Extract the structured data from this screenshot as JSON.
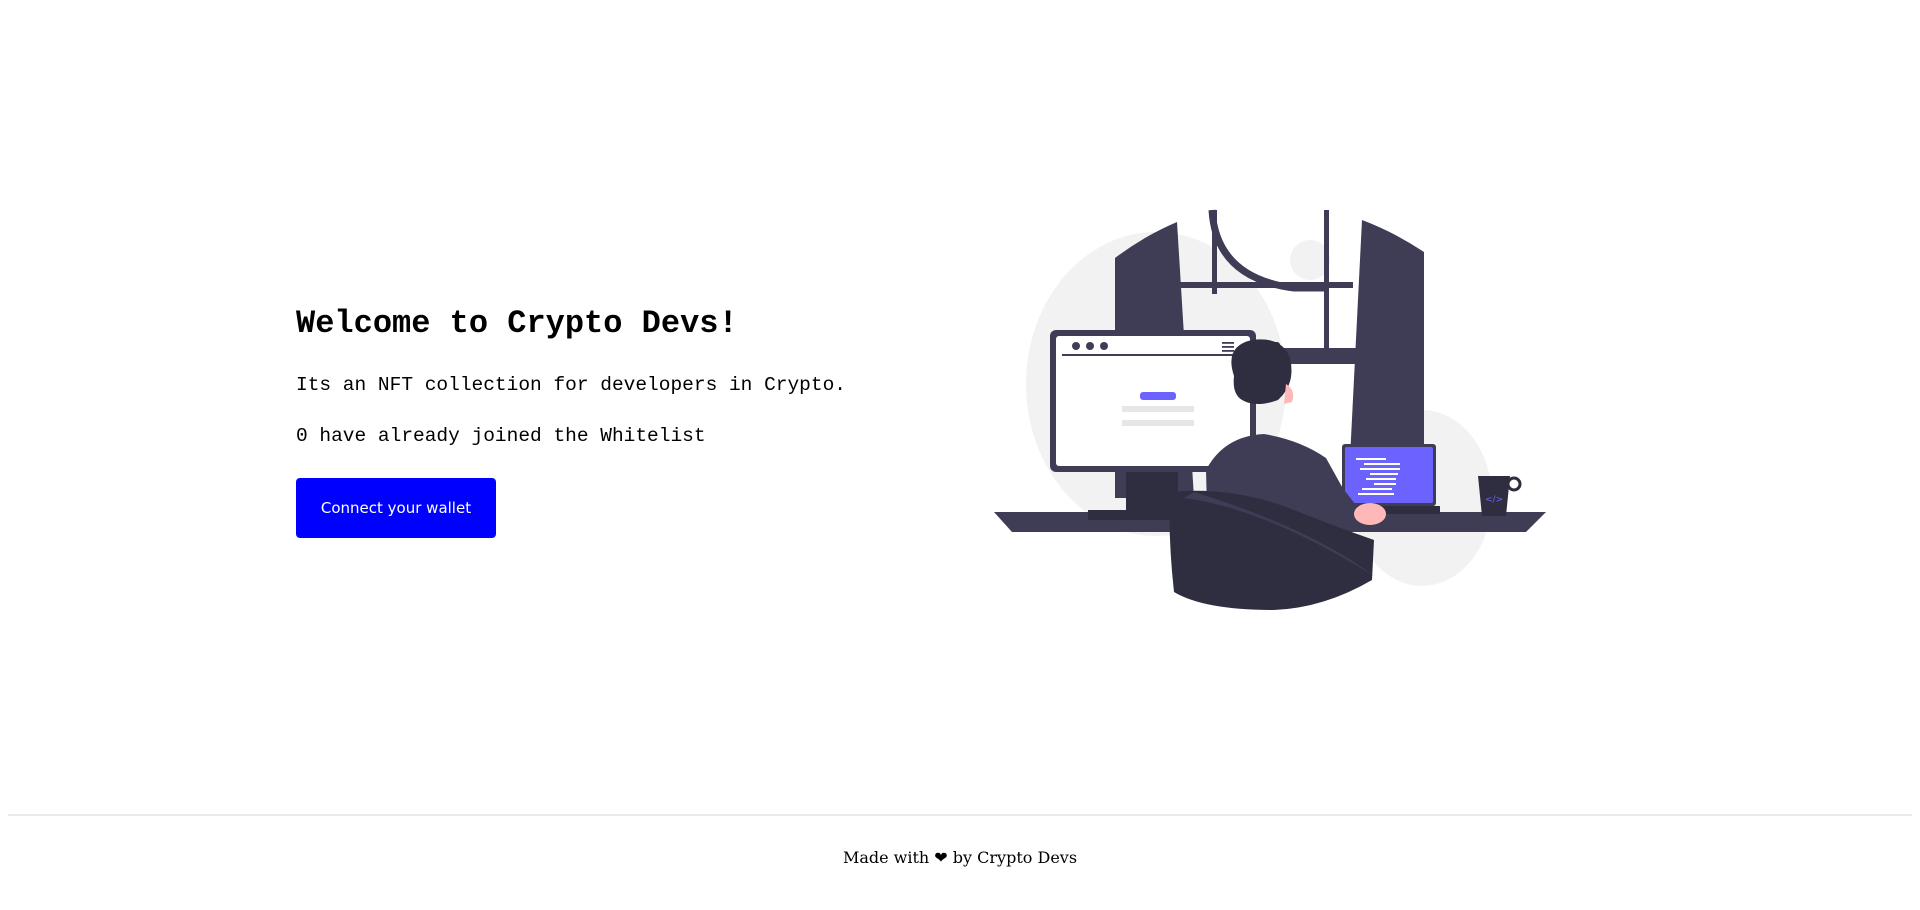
{
  "hero": {
    "title": "Welcome to Crypto Devs!",
    "description": "Its an NFT collection for developers in Crypto.",
    "whitelist_status": "0 have already joined the Whitelist",
    "connect_button_label": "Connect your wallet"
  },
  "illustration": {
    "icon": "developer-at-desk-illustration",
    "accent_color": "#6c63ff",
    "dark_color": "#3f3d56"
  },
  "footer": {
    "text": "Made with ❤ by Crypto Devs"
  },
  "colors": {
    "button_background": "#0000ff",
    "button_text": "#ffffff",
    "text": "#000000"
  }
}
